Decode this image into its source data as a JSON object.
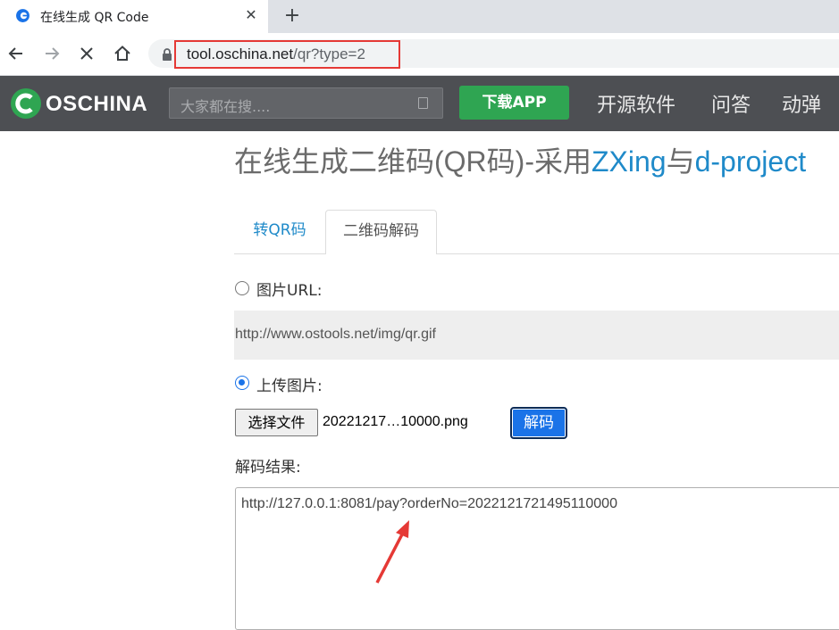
{
  "browser": {
    "tab": {
      "title": "在线生成 QR Code",
      "close": "✕"
    },
    "new_tab": "+",
    "address": {
      "host": "tool.oschina.net",
      "path": "/qr?type=2"
    }
  },
  "site": {
    "logo_text": "OSCHINA",
    "search_placeholder": "大家都在搜....",
    "download_button": "下载APP",
    "nav": [
      "开源软件",
      "问答",
      "动弹"
    ]
  },
  "page": {
    "title_prefix": "在线生成二维码(QR码)-采用",
    "title_zxing": "ZXing",
    "title_mid": "与",
    "title_dproject": "d-project",
    "tabs": [
      {
        "label": "转QR码",
        "active": false
      },
      {
        "label": "二维码解码",
        "active": true
      }
    ],
    "image_url_label": "图片URL:",
    "image_url_value": "http://www.ostools.net/img/qr.gif",
    "upload_label": "上传图片:",
    "choose_file_button": "选择文件",
    "file_name": "20221217…10000.png",
    "decode_button": "解码",
    "result_label": "解码结果:",
    "result_value": "http://127.0.0.1:8081/pay?orderNo=2022121721495110000"
  },
  "colors": {
    "annotation_red": "#e53935",
    "link_blue": "#1f8ac9",
    "download_green": "#2fa552",
    "header_bg": "#4d4f53"
  }
}
